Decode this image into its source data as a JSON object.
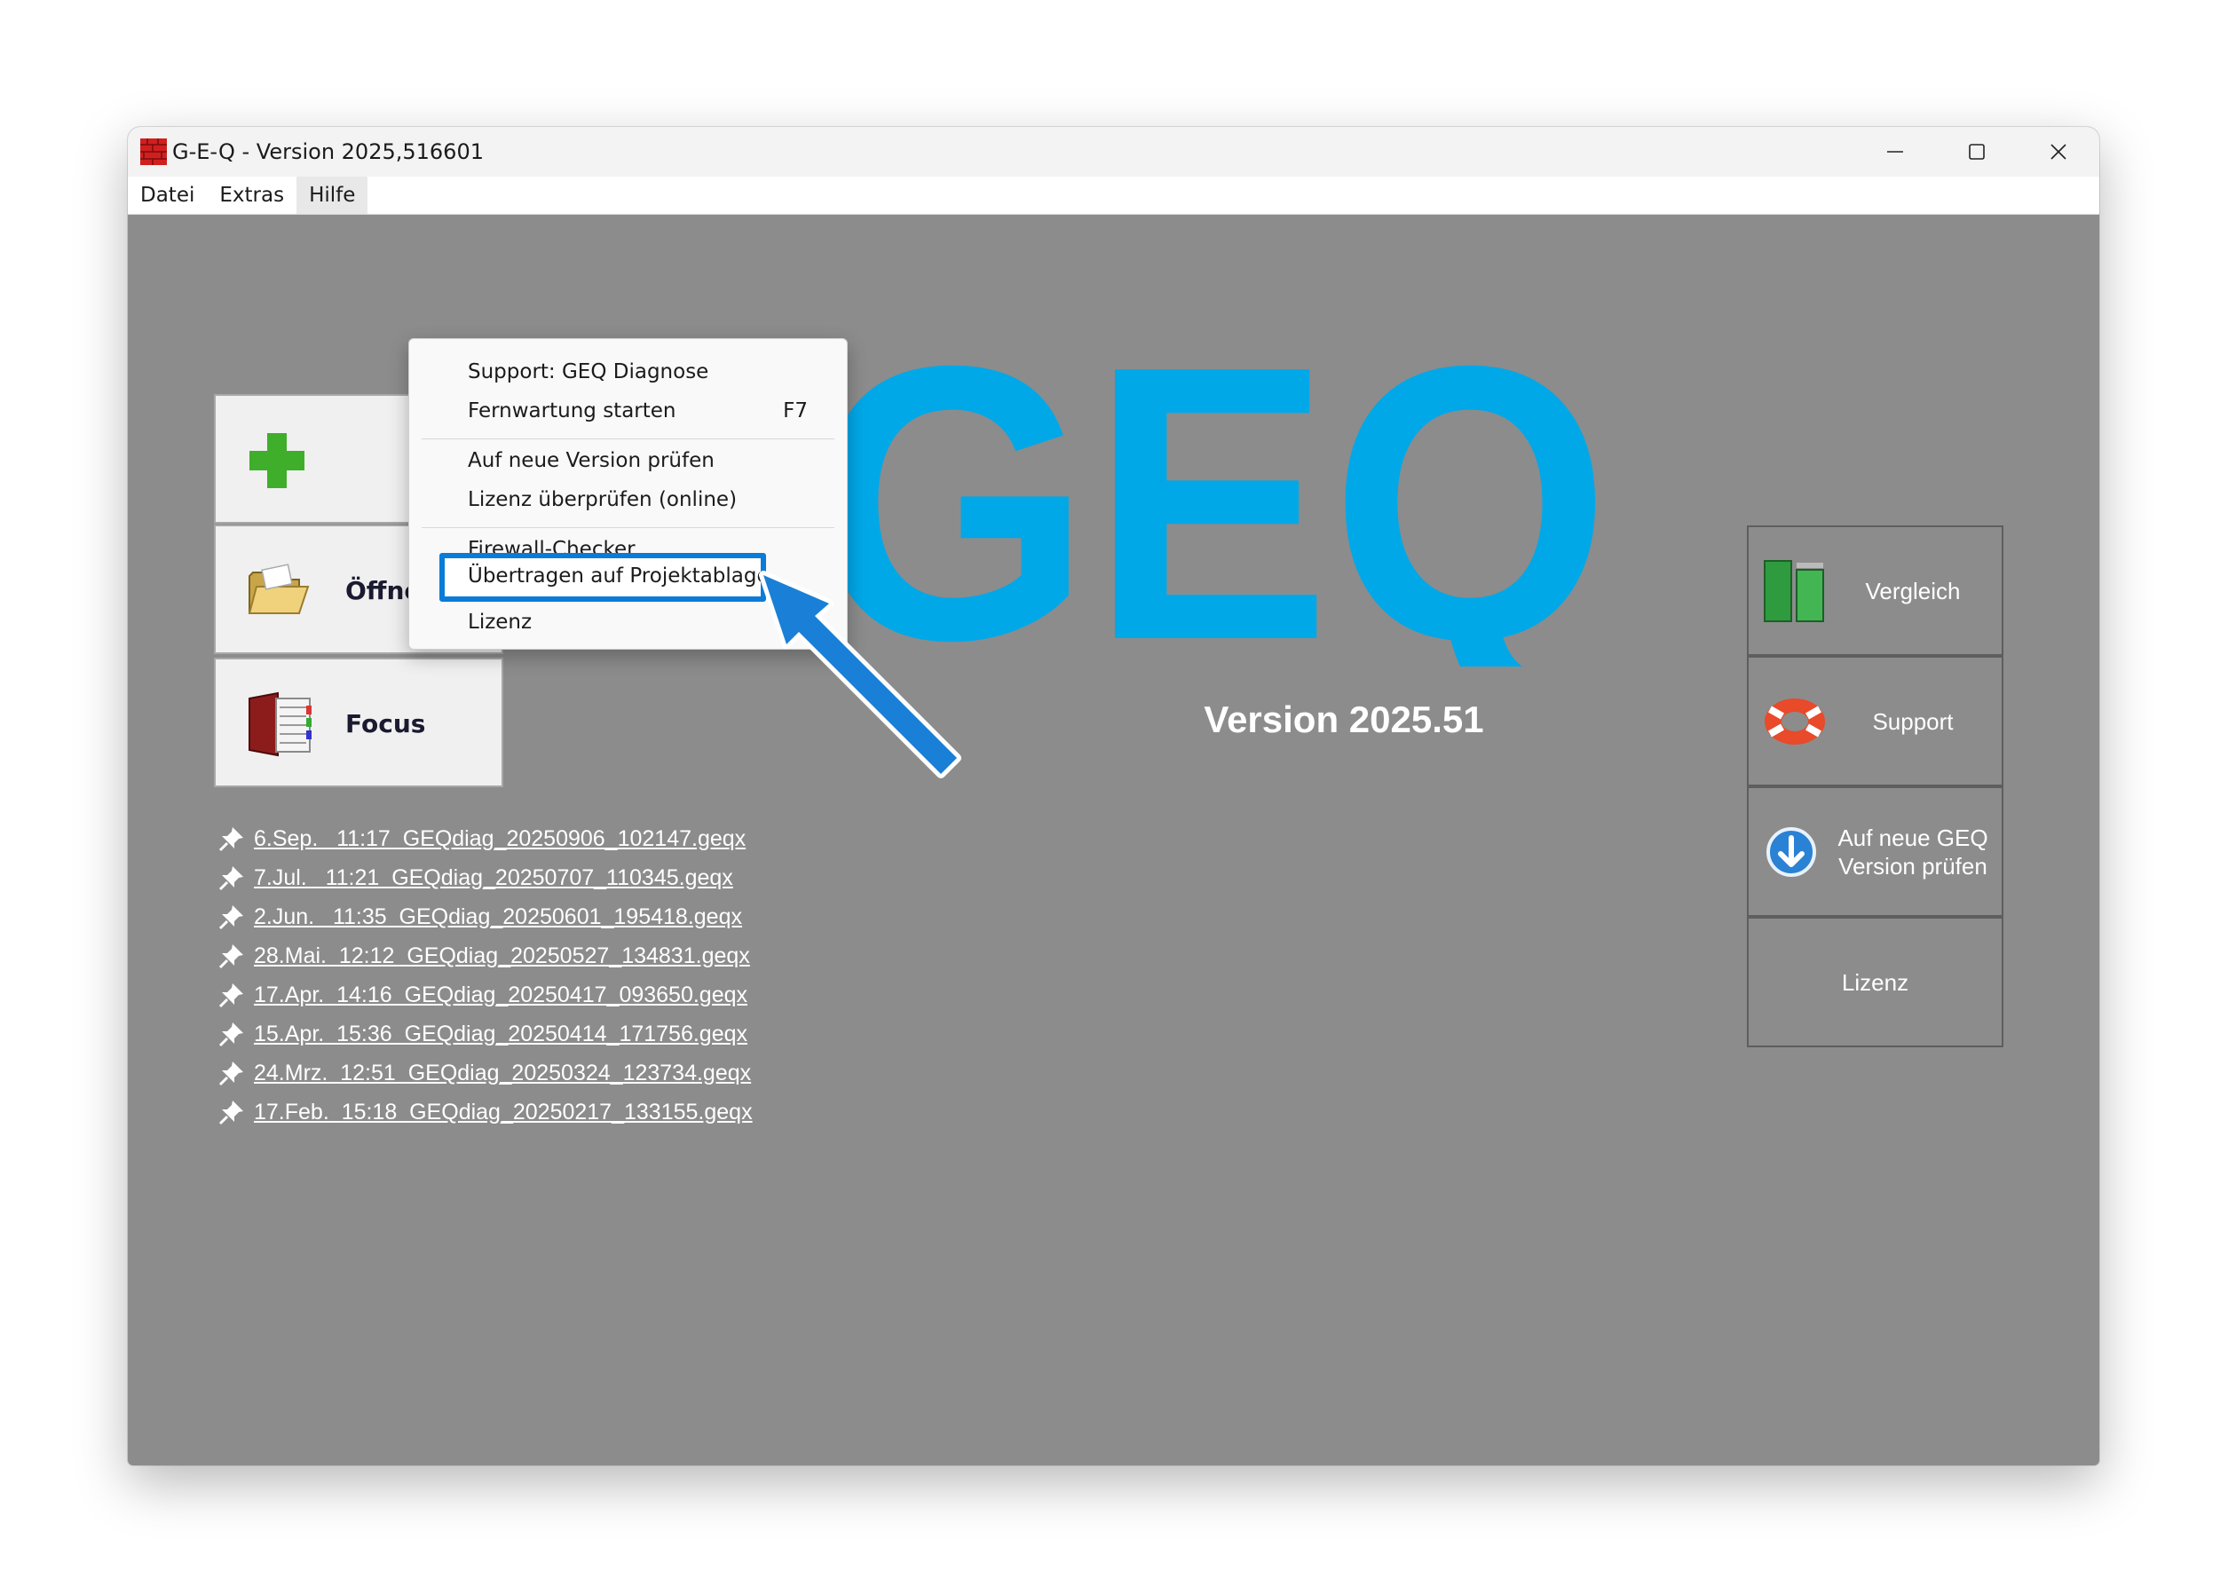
{
  "window": {
    "title": "G-E-Q - Version 2025,516601"
  },
  "menubar": {
    "items": [
      "Datei",
      "Extras",
      "Hilfe"
    ]
  },
  "hilfe_menu": {
    "items": [
      {
        "label": "Support: GEQ Diagnose",
        "shortcut": ""
      },
      {
        "label": "Fernwartung starten",
        "shortcut": "F7"
      },
      {
        "label": "Auf neue Version prüfen",
        "shortcut": ""
      },
      {
        "label": "Lizenz überprüfen (online)",
        "shortcut": ""
      },
      {
        "label": "Firewall-Checker",
        "shortcut": ""
      },
      {
        "label": "Übertragen auf Projektablage",
        "shortcut": "",
        "highlighted": true
      },
      {
        "label": "Lizenz",
        "shortcut": ""
      }
    ]
  },
  "left_buttons": {
    "open_label": "Öffnen",
    "focus_label": "Focus"
  },
  "logo": {
    "text": "GEQ",
    "color": "#00a8e8"
  },
  "version_label": "Version 2025.51",
  "recent_files": [
    "6.Sep.   11:17  GEQdiag_20250906_102147.geqx",
    "7.Jul.   11:21  GEQdiag_20250707_110345.geqx",
    "2.Jun.   11:35  GEQdiag_20250601_195418.geqx",
    "28.Mai.  12:12  GEQdiag_20250527_134831.geqx",
    "17.Apr.  14:16  GEQdiag_20250417_093650.geqx",
    "15.Apr.  15:36  GEQdiag_20250414_171756.geqx",
    "24.Mrz.  12:51  GEQdiag_20250324_123734.geqx",
    "17.Feb.  15:18  GEQdiag_20250217_133155.geqx"
  ],
  "right_buttons": {
    "compare_label": "Vergleich",
    "support_label": "Support",
    "update_label": "Auf neue GEQ Version prüfen",
    "license_label": "Lizenz"
  },
  "colors": {
    "background": "#8c8c8c",
    "highlight_border": "#0b7bd9",
    "arrow": "#1a7fd6"
  }
}
